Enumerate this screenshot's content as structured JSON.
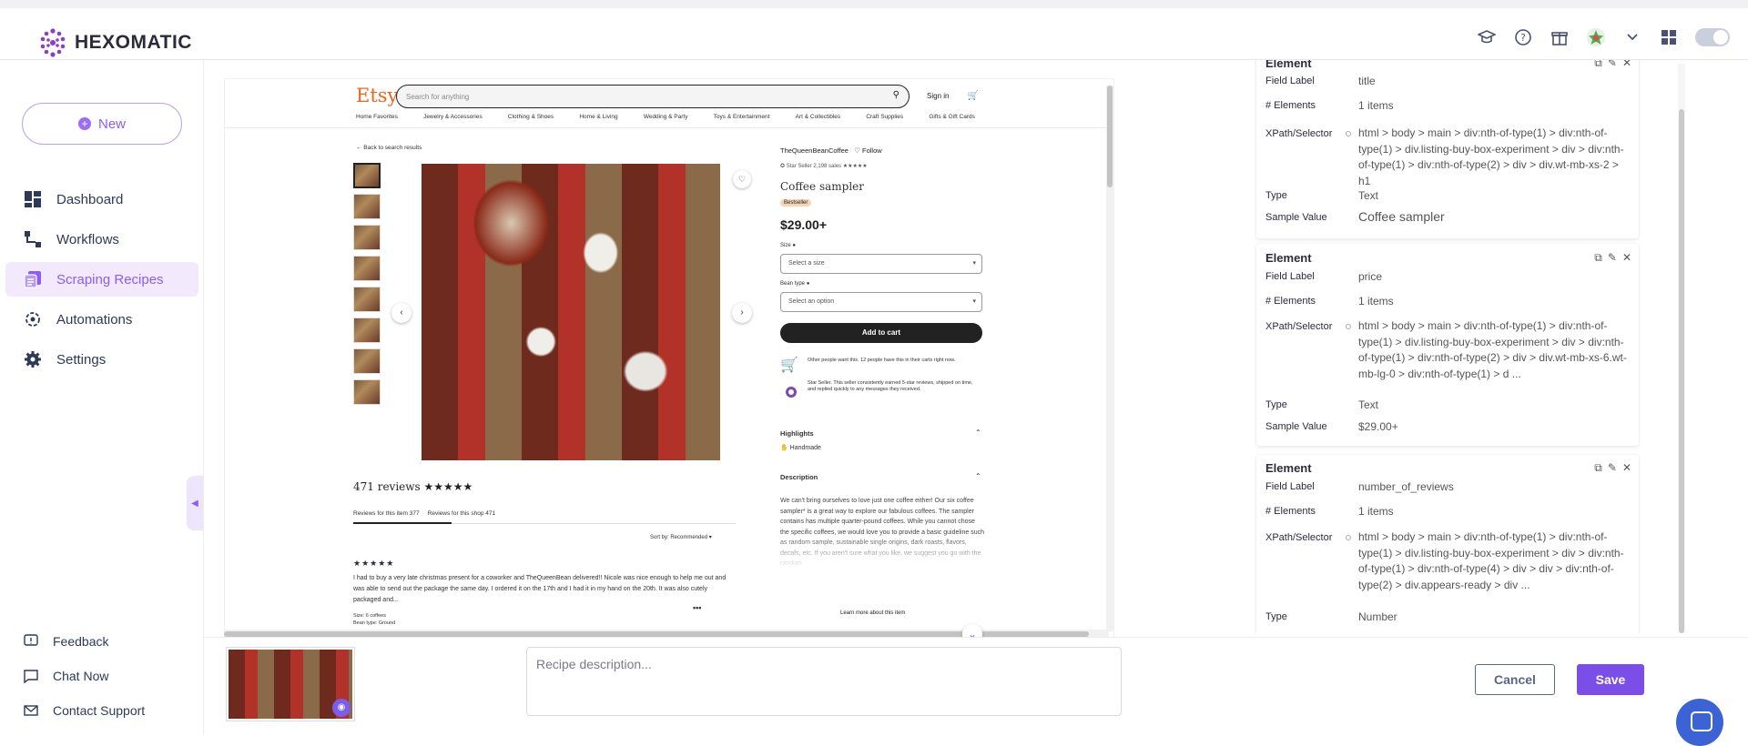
{
  "app": {
    "name": "HEXOMATIC"
  },
  "sidebar": {
    "new_label": "New",
    "items": [
      {
        "label": "Dashboard",
        "icon": "dashboard-icon"
      },
      {
        "label": "Workflows",
        "icon": "workflow-icon"
      },
      {
        "label": "Scraping Recipes",
        "icon": "recipes-icon",
        "active": true
      },
      {
        "label": "Automations",
        "icon": "automation-icon"
      },
      {
        "label": "Settings",
        "icon": "gear-icon"
      }
    ],
    "footer": [
      {
        "label": "Feedback",
        "icon": "feedback-icon"
      },
      {
        "label": "Chat Now",
        "icon": "chat-icon"
      },
      {
        "label": "Contact Support",
        "icon": "mail-icon"
      }
    ]
  },
  "colors": {
    "accent": "#7b4ee8",
    "active_bg": "#f2eafc",
    "etsy_orange": "#f1641e"
  },
  "etsy": {
    "logo": "Etsy",
    "search_placeholder": "Search for anything",
    "sign_in": "Sign in",
    "categories": [
      "Home Favorites",
      "Jewelry & Accessories",
      "Clothing & Shoes",
      "Home & Living",
      "Wedding & Party",
      "Toys & Entertainment",
      "Art & Collectibles",
      "Craft Supplies",
      "Gifts & Gift Cards"
    ],
    "back": "← Back to search results",
    "shop": "TheQueenBeanCoffee",
    "follow": "♡ Follow",
    "star_seller": "✪ Star Seller   2,198 sales  ★★★★★",
    "product_title": "Coffee sampler",
    "badge": "Bestseller",
    "price": "$29.00+",
    "size_label": "Size ●",
    "size_placeholder": "Select a size",
    "bean_label": "Bean type ●",
    "bean_placeholder": "Select an option",
    "add_to_cart": "Add to cart",
    "note_1": "Other people want this. 12 people have this in their carts right now.",
    "note_2": "Star Seller. This seller consistently earned 5-star reviews, shipped on time, and replied quickly to any messages they received.",
    "highlights": "Highlights",
    "handmade": "Handmade",
    "description_h": "Description",
    "description": "We can't bring ourselves to love just one coffee either! Our six coffee sampler* is a great way to explore our fabulous coffees. The sampler contains has multiple quarter-pound coffees. While you cannot chose the specific coffees, we would love you to provide a basic guideline such as random sample, sustainable single origins, dark roasts, flavors, decafs, etc. If you aren't sure what you like, we suggest you go with the random",
    "learn_more": "Learn more about this item",
    "reviews_count": "471 reviews ★★★★★",
    "tab_item": "Reviews for this item  377",
    "tab_shop": "Reviews for this shop  471",
    "sort_by": "Sort by: Recommended ▾",
    "review_stars": "★★★★★",
    "review_text": "I had to buy a very late christmas present for a coworker and TheQueenBean delivered!! Nicole was nice enough to help me out and was able to send out the package the same day. I ordered it on the 17th and I had it in my hand on the 20th. It was also cutely packaged and...",
    "review_size": "Size: 6 coffees",
    "review_bean": "Bean type: Ground"
  },
  "elements": [
    {
      "title": "Element",
      "field_label_key": "Field Label",
      "field_label": "title",
      "count_key": "# Elements",
      "count": "1 items",
      "xpath_key": "XPath/Selector",
      "xpath": "html > body > main > div:nth-of-type(1) > div:nth-of-type(1) > div.listing-buy-box-experiment > div > div:nth-of-type(1) > div:nth-of-type(2) > div > div.wt-mb-xs-2 > h1",
      "type_key": "Type",
      "type": "Text",
      "sample_key": "Sample Value",
      "sample": "Coffee sampler"
    },
    {
      "title": "Element",
      "field_label_key": "Field Label",
      "field_label": "price",
      "count_key": "# Elements",
      "count": "1 items",
      "xpath_key": "XPath/Selector",
      "xpath": "html > body > main > div:nth-of-type(1) > div:nth-of-type(1) > div.listing-buy-box-experiment > div > div:nth-of-type(1) > div:nth-of-type(2) > div > div.wt-mb-xs-6.wt-mb-lg-0 > div:nth-of-type(1) > d ...",
      "type_key": "Type",
      "type": "Text",
      "sample_key": "Sample Value",
      "sample": "$29.00+"
    },
    {
      "title": "Element",
      "field_label_key": "Field Label",
      "field_label": "number_of_reviews",
      "count_key": "# Elements",
      "count": "1 items",
      "xpath_key": "XPath/Selector",
      "xpath": "html > body > main > div:nth-of-type(1) > div:nth-of-type(1) > div.listing-buy-box-experiment > div > div:nth-of-type(1) > div:nth-of-type(4) > div > div > div:nth-of-type(2) > div.appears-ready > div ...",
      "type_key": "Type",
      "type": "Number"
    }
  ],
  "bottom": {
    "description_placeholder": "Recipe description...",
    "cancel": "Cancel",
    "save": "Save"
  }
}
